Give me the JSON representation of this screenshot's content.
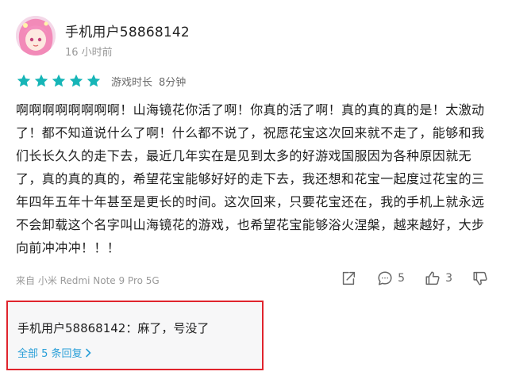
{
  "post": {
    "user_name": "手机用户58868142",
    "time": "16 小时前",
    "rating": 5,
    "rating_max": 5,
    "play_time_label": "游戏时长",
    "play_time_value": "8分钟",
    "body": "啊啊啊啊啊啊啊啊！山海镜花你活了啊！你真的活了啊！真的真的真的是！太激动了！都不知道说什么了啊！什么都不说了，祝愿花宝这次回来就不走了，能够和我们长长久久的走下去，最近几年实在是见到太多的好游戏国服因为各种原因就无了，真的真的真的，希望花宝能够好好的走下去，我还想和花宝一起度过花宝的三年四年五年十年甚至是更长的时间。这次回来，只要花宝还在，我的手机上就永远不会卸载这个名字叫山海镜花的游戏，也希望花宝能够浴火涅槃，越来越好，大步向前冲冲冲！！！",
    "device": "来自 小米 Redmi Note 9 Pro 5G",
    "comment_count": "5",
    "like_count": "3"
  },
  "reply": {
    "text": "手机用户58868142：麻了，号没了",
    "more_label": "全部 5 条回复"
  },
  "colors": {
    "star": "#16b5b7",
    "link": "#2a9fd8",
    "highlight_border": "#e0242d"
  },
  "icons": {
    "share": "share-icon",
    "comment": "comment-icon",
    "like": "thumbs-up-icon",
    "dislike": "thumbs-down-icon"
  }
}
